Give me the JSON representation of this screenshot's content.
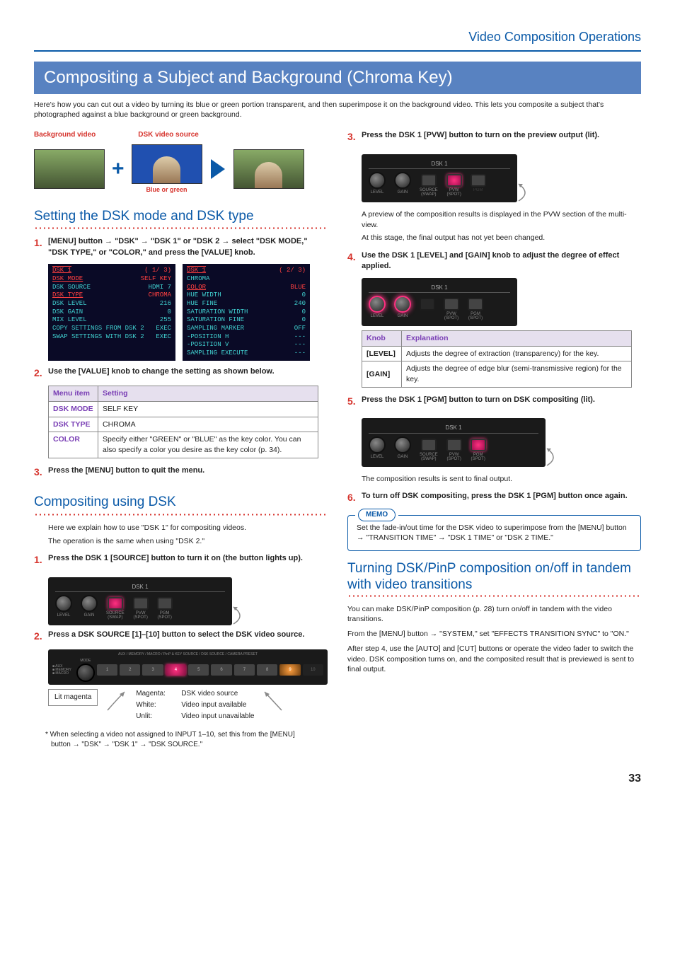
{
  "breadcrumb": "Video Composition Operations",
  "title": "Compositing a Subject and Background (Chroma Key)",
  "intro": "Here's how you can cut out a video by turning its blue or green portion transparent, and then superimpose it on the background video. This lets you composite a subject that's photographed against a blue background or green background.",
  "diagram": {
    "bg_label": "Background video",
    "dsk_label": "DSK video source",
    "blue_green": "Blue or green"
  },
  "sectionA": {
    "title": "Setting the DSK mode and DSK type",
    "step1": "[MENU] button → \"DSK\" → \"DSK 1\" or \"DSK 2 → select \"DSK MODE,\" \"DSK TYPE,\" or \"COLOR,\" and press the [VALUE] knob.",
    "step2": "Use the [VALUE] knob to change the setting as shown below.",
    "step3": "Press the [MENU] button to quit the menu.",
    "table": {
      "h1": "Menu item",
      "h2": "Setting",
      "rows": [
        {
          "k": "DSK MODE",
          "v": "SELF KEY"
        },
        {
          "k": "DSK TYPE",
          "v": "CHROMA"
        },
        {
          "k": "COLOR",
          "v": "Specify either \"GREEN\" or \"BLUE\" as the key color. You can also specify a color you desire as the key color (p. 34)."
        }
      ]
    }
  },
  "menu1": {
    "title": "DSK 1",
    "page": "(  1/  3)",
    "lines": [
      {
        "l": "DSK MODE",
        "r": "SELF KEY",
        "cls": "red-text"
      },
      {
        "l": "DSK SOURCE",
        "r": "HDMI 7"
      },
      {
        "l": " ",
        "r": " "
      },
      {
        "l": "DSK TYPE",
        "r": "CHROMA",
        "cls": "red-text"
      },
      {
        "l": "DSK LEVEL",
        "r": "216"
      },
      {
        "l": "DSK GAIN",
        "r": "0"
      },
      {
        "l": "MIX LEVEL",
        "r": "255"
      },
      {
        "l": " ",
        "r": " "
      },
      {
        "l": "COPY SETTINGS FROM DSK 2",
        "r": "EXEC"
      },
      {
        "l": "SWAP SETTINGS WITH DSK 2",
        "r": "EXEC"
      }
    ]
  },
  "menu2": {
    "title": "DSK 1",
    "page": "(  2/  3)",
    "sub": "CHROMA",
    "lines": [
      {
        "l": " COLOR",
        "r": "BLUE",
        "cls": "red-text"
      },
      {
        "l": "  HUE WIDTH",
        "r": "0"
      },
      {
        "l": "  HUE FINE",
        "r": "240"
      },
      {
        "l": "  SATURATION WIDTH",
        "r": "0"
      },
      {
        "l": "  SATURATION FINE",
        "r": "0"
      },
      {
        "l": " ",
        "r": " "
      },
      {
        "l": " SAMPLING MARKER",
        "r": "OFF"
      },
      {
        "l": "  -POSITION H",
        "r": "---"
      },
      {
        "l": "  -POSITION V",
        "r": "---"
      },
      {
        "l": " ",
        "r": " "
      },
      {
        "l": " SAMPLING EXECUTE",
        "r": "---"
      }
    ]
  },
  "sectionB": {
    "title": "Compositing using DSK",
    "intro1": "Here we explain how to use \"DSK 1\" for compositing videos.",
    "intro2": "The operation is the same when using \"DSK 2.\"",
    "step1": "Press the DSK 1 [SOURCE] button to turn it on (the button lights up).",
    "step2": "Press a DSK SOURCE [1]–[10] button to select the DSK video source.",
    "lit_magenta": "Lit magenta",
    "legend": [
      {
        "color": "Magenta:",
        "meaning": "DSK video source"
      },
      {
        "color": "White:",
        "meaning": "Video input available"
      },
      {
        "color": "Unlit:",
        "meaning": "Video input unavailable"
      }
    ],
    "footnote": "* When selecting a video not assigned to INPUT 1–10, set this from the [MENU] button → \"DSK\" → \"DSK 1\" → \"DSK SOURCE.\""
  },
  "sectionC": {
    "step3": "Press the DSK 1 [PVW] button to turn on the preview output (lit).",
    "step3_note1": "A preview of the composition results is displayed in the PVW section of the multi-view.",
    "step3_note2": "At this stage, the final output has not yet been changed.",
    "step4": "Use the DSK 1 [LEVEL] and [GAIN] knob to adjust the degree of effect applied.",
    "knob_table": {
      "h1": "Knob",
      "h2": "Explanation",
      "rows": [
        {
          "k": "[LEVEL]",
          "v": "Adjusts the degree of extraction (transparency) for the key."
        },
        {
          "k": "[GAIN]",
          "v": "Adjusts the degree of edge blur (semi-transmissive region) for the key."
        }
      ]
    },
    "step5": "Press the DSK 1 [PGM] button to turn on DSK compositing (lit).",
    "step5_note": "The composition results is sent to final output.",
    "step6": "To turn off DSK compositing, press the DSK 1 [PGM] button once again."
  },
  "memo": {
    "tag": "MEMO",
    "body": "Set the fade-in/out time for the DSK video to superimpose from the [MENU] button → \"TRANSITION TIME\" → \"DSK 1 TIME\" or \"DSK 2 TIME.\""
  },
  "sectionD": {
    "title": "Turning DSK/PinP composition on/off in tandem with video transitions",
    "p1": "You can make DSK/PinP composition (p. 28) turn on/off in tandem with the video transitions.",
    "p2": "From the [MENU] button → \"SYSTEM,\" set \"EFFECTS TRANSITION SYNC\" to \"ON.\"",
    "p3": "After step 4, use the [AUTO] and [CUT] buttons or operate the video fader to switch the video. DSK composition turns on, and the composited result that is previewed is sent to final output."
  },
  "ctrl_labels": {
    "dsk1": "DSK 1",
    "level": "LEVEL",
    "gain": "GAIN",
    "source": "SOURCE",
    "swap": "(SWAP)",
    "pvw": "PVW",
    "spot": "(SPOT)",
    "pgm": "PGM"
  },
  "hw_top": "AUX  /  MEMORY  /  MACRO  /  PinP & KEY SOURCE  /  DSK SOURCE  /  CAMERA PRESET",
  "hw_mode": "MODE",
  "page_number": "33"
}
